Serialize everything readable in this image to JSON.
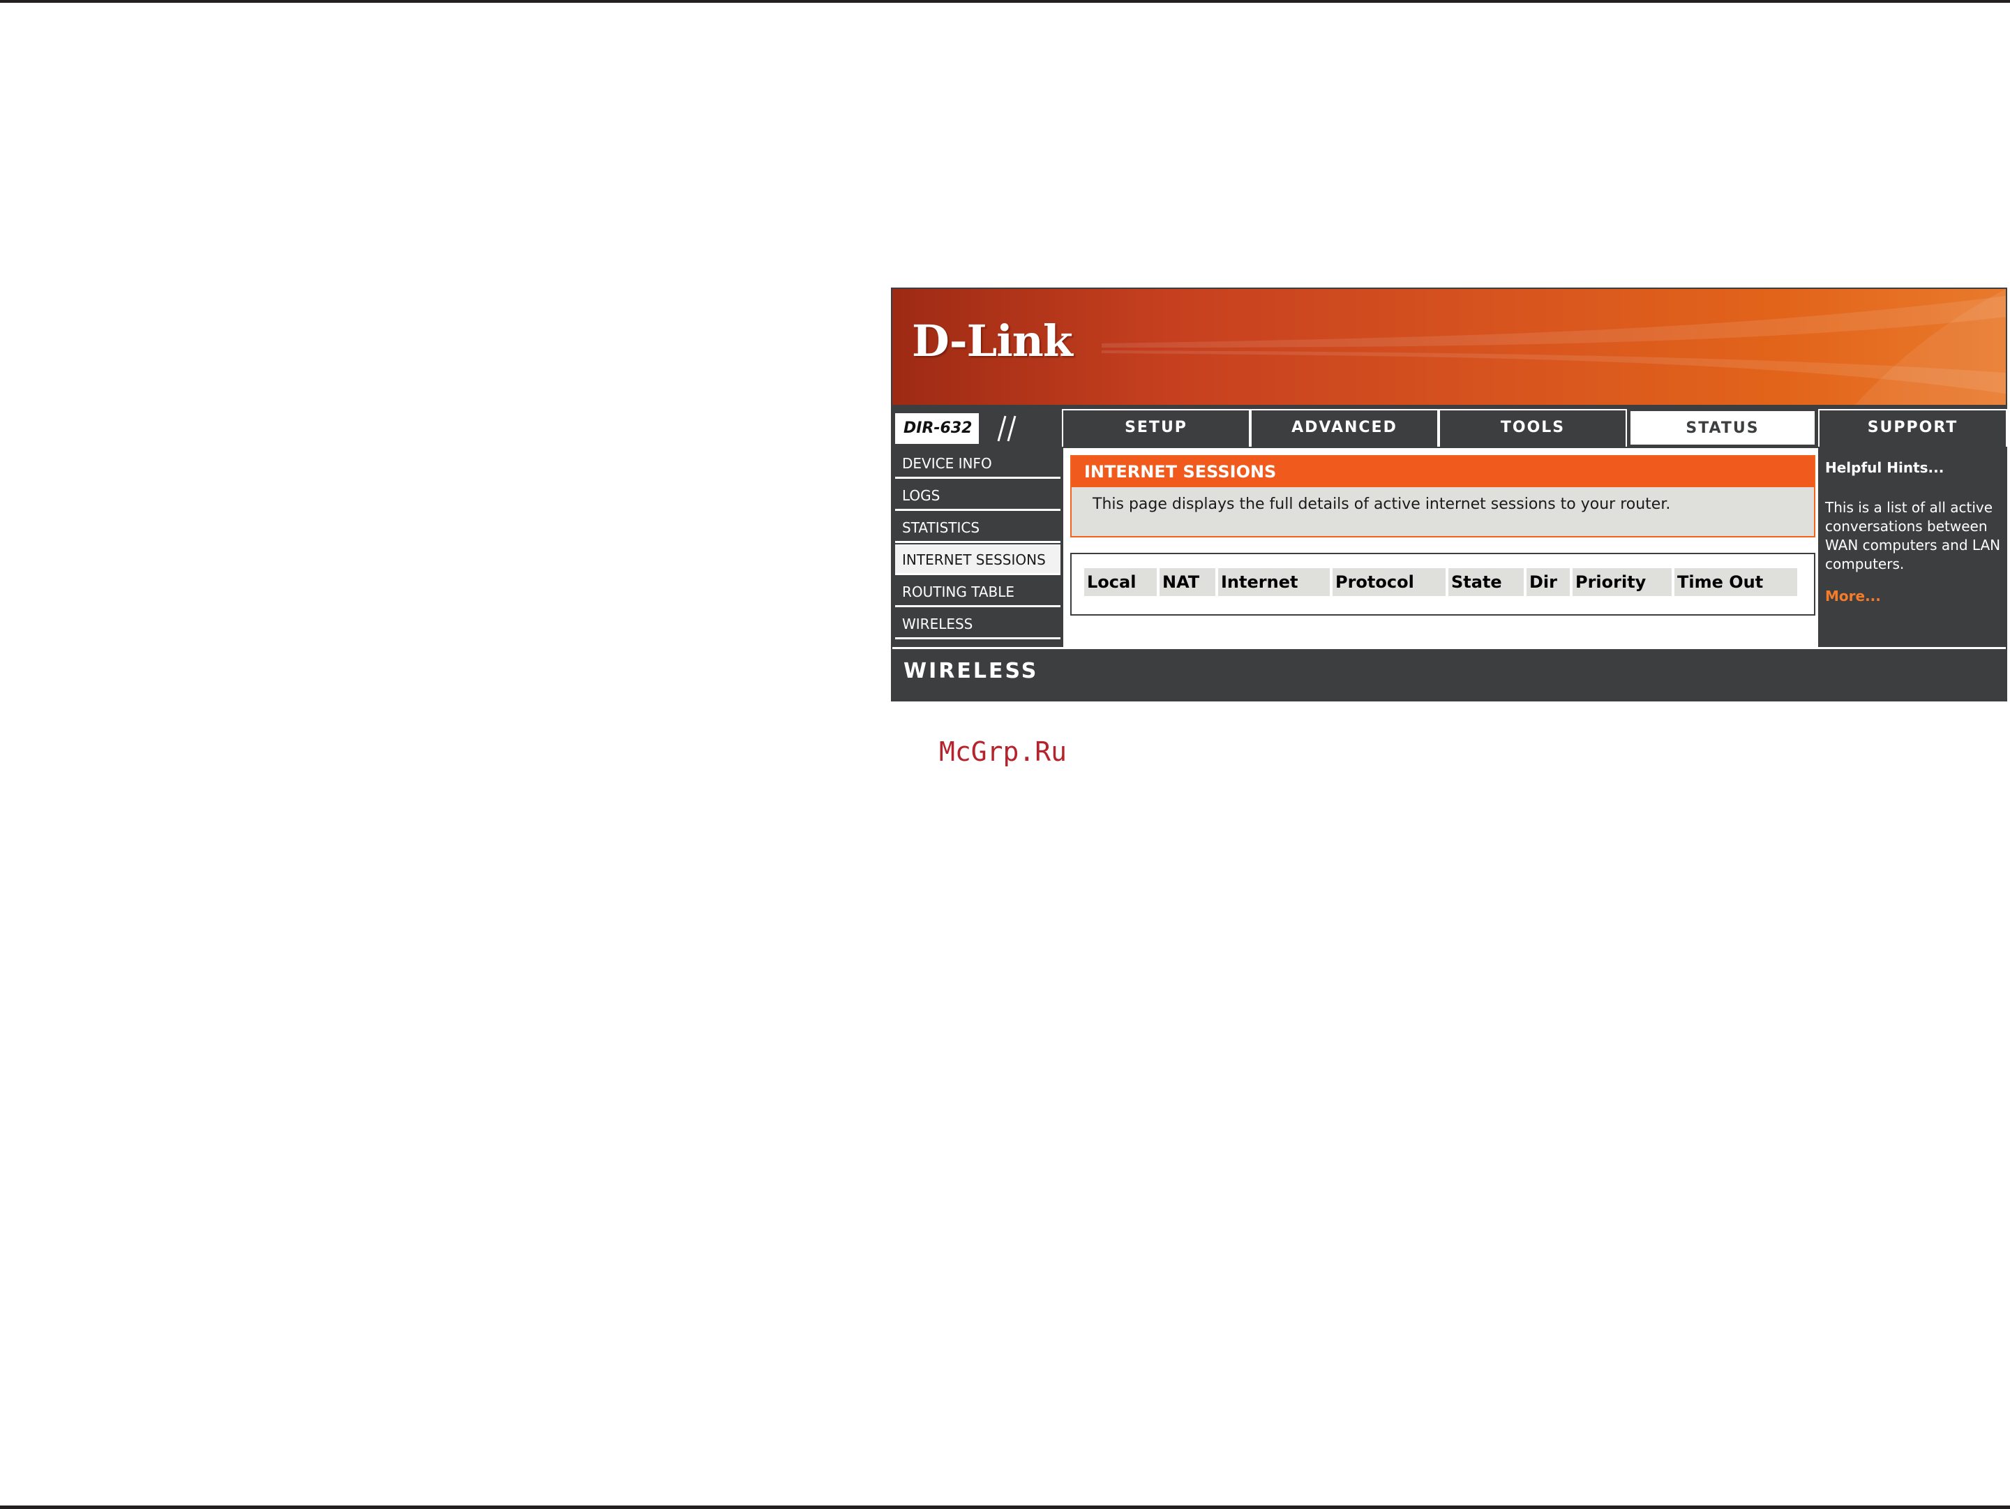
{
  "brand": {
    "logo": "D-Link",
    "model": "DIR-632"
  },
  "nav": {
    "tabs": [
      {
        "label": "SETUP"
      },
      {
        "label": "ADVANCED"
      },
      {
        "label": "TOOLS"
      },
      {
        "label": "STATUS",
        "active": true
      },
      {
        "label": "SUPPORT"
      }
    ]
  },
  "sidebar": {
    "items": [
      {
        "label": "DEVICE INFO"
      },
      {
        "label": "LOGS"
      },
      {
        "label": "STATISTICS"
      },
      {
        "label": "INTERNET SESSIONS",
        "active": true
      },
      {
        "label": "ROUTING TABLE"
      },
      {
        "label": "WIRELESS"
      }
    ]
  },
  "main": {
    "section_title": "INTERNET SESSIONS",
    "description": "This page displays the full details of active internet sessions to your router.",
    "table": {
      "columns": [
        "Local",
        "NAT",
        "Internet",
        "Protocol",
        "State",
        "Dir",
        "Priority",
        "Time Out"
      ],
      "rows": []
    }
  },
  "hints": {
    "title": "Helpful Hints...",
    "text": "This is a list of all active conversations between WAN computers and LAN computers.",
    "more": "More..."
  },
  "footer": {
    "label": "WIRELESS"
  },
  "watermark": "McGrp.Ru",
  "colors": {
    "banner_orange": "#d7541f",
    "section_orange": "#f05a1c",
    "dark_gray": "#3c3e40",
    "hint_link": "#f47c2a",
    "watermark_red": "#b5242c"
  }
}
